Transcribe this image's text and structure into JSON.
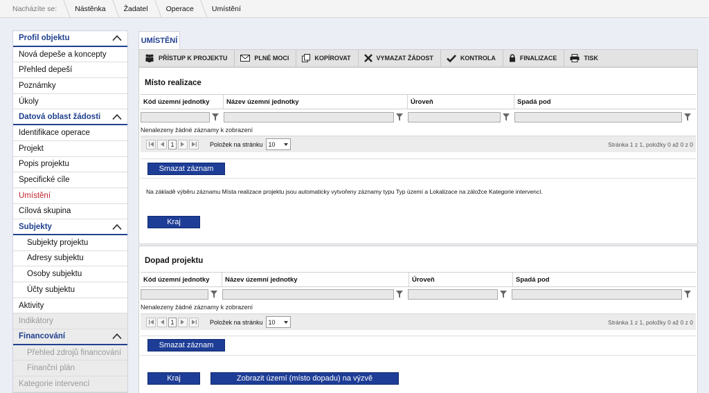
{
  "breadcrumb": {
    "label": "Nacházíte se:",
    "items": [
      "Nástěnka",
      "Žadatel",
      "Operace",
      "Umístění"
    ]
  },
  "sidebar": {
    "items": [
      {
        "label": "Profil objektu",
        "type": "section"
      },
      {
        "label": "Nová depeše a koncepty",
        "type": "item"
      },
      {
        "label": "Přehled depeší",
        "type": "item"
      },
      {
        "label": "Poznámky",
        "type": "item"
      },
      {
        "label": "Úkoly",
        "type": "item"
      },
      {
        "label": "Datová oblast žádosti",
        "type": "section"
      },
      {
        "label": "Identifikace operace",
        "type": "item"
      },
      {
        "label": "Projekt",
        "type": "item"
      },
      {
        "label": "Popis projektu",
        "type": "item"
      },
      {
        "label": "Specifické cíle",
        "type": "item"
      },
      {
        "label": "Umístění",
        "type": "active"
      },
      {
        "label": "Cílová skupina",
        "type": "item"
      },
      {
        "label": "Subjekty",
        "type": "section"
      },
      {
        "label": "Subjekty projektu",
        "type": "sub"
      },
      {
        "label": "Adresy subjektu",
        "type": "sub"
      },
      {
        "label": "Osoby subjektu",
        "type": "sub"
      },
      {
        "label": "Účty subjektu",
        "type": "sub"
      },
      {
        "label": "Aktivity",
        "type": "item"
      },
      {
        "label": "Indikátory",
        "type": "disabled"
      },
      {
        "label": "Financování",
        "type": "section-disabled"
      },
      {
        "label": "Přehled zdrojů financování",
        "type": "sub-disabled"
      },
      {
        "label": "Finanční plán",
        "type": "sub-disabled"
      },
      {
        "label": "Kategorie intervencí",
        "type": "disabled"
      }
    ]
  },
  "tab": {
    "label": "UMÍSTĚNÍ"
  },
  "toolbar": {
    "buttons": [
      {
        "label": "PŘÍSTUP K PROJEKTU",
        "icon": "people-icon"
      },
      {
        "label": "PLNÉ MOCI",
        "icon": "envelope-icon"
      },
      {
        "label": "KOPÍROVAT",
        "icon": "copy-icon"
      },
      {
        "label": "VYMAZAT ŽÁDOST",
        "icon": "x-icon"
      },
      {
        "label": "KONTROLA",
        "icon": "check-icon"
      },
      {
        "label": "FINALIZACE",
        "icon": "lock-icon"
      },
      {
        "label": "TISK",
        "icon": "printer-icon"
      }
    ]
  },
  "columns": [
    "Kód územní jednotky",
    "Název územní jednotky",
    "Úroveň",
    "Spadá pod"
  ],
  "section1": {
    "title": "Místo realizace",
    "empty": "Nenalezeny žádné záznamy k zobrazení",
    "page": "1",
    "per_page_label": "Položek na stránku",
    "per_page": "10",
    "page_info": "Stránka 1 z 1, položky 0 až 0 z 0",
    "delete_btn": "Smazat záznam",
    "info_text": "Na základě výběru záznamu Místa realizace projektu jsou automaticky vytvořeny záznamy typu Typ území a Lokalizace na záložce Kategorie intervencí.",
    "kraj_btn": "Kraj"
  },
  "section2": {
    "title": "Dopad projektu",
    "empty": "Nenalezeny žádné záznamy k zobrazení",
    "page": "1",
    "per_page_label": "Položek na stránku",
    "per_page": "10",
    "page_info": "Stránka 1 z 1, položky 0 až 0 z 0",
    "delete_btn": "Smazat záznam",
    "kraj_btn": "Kraj",
    "show_btn": "Zobrazit území (místo dopadu) na výzvě"
  }
}
